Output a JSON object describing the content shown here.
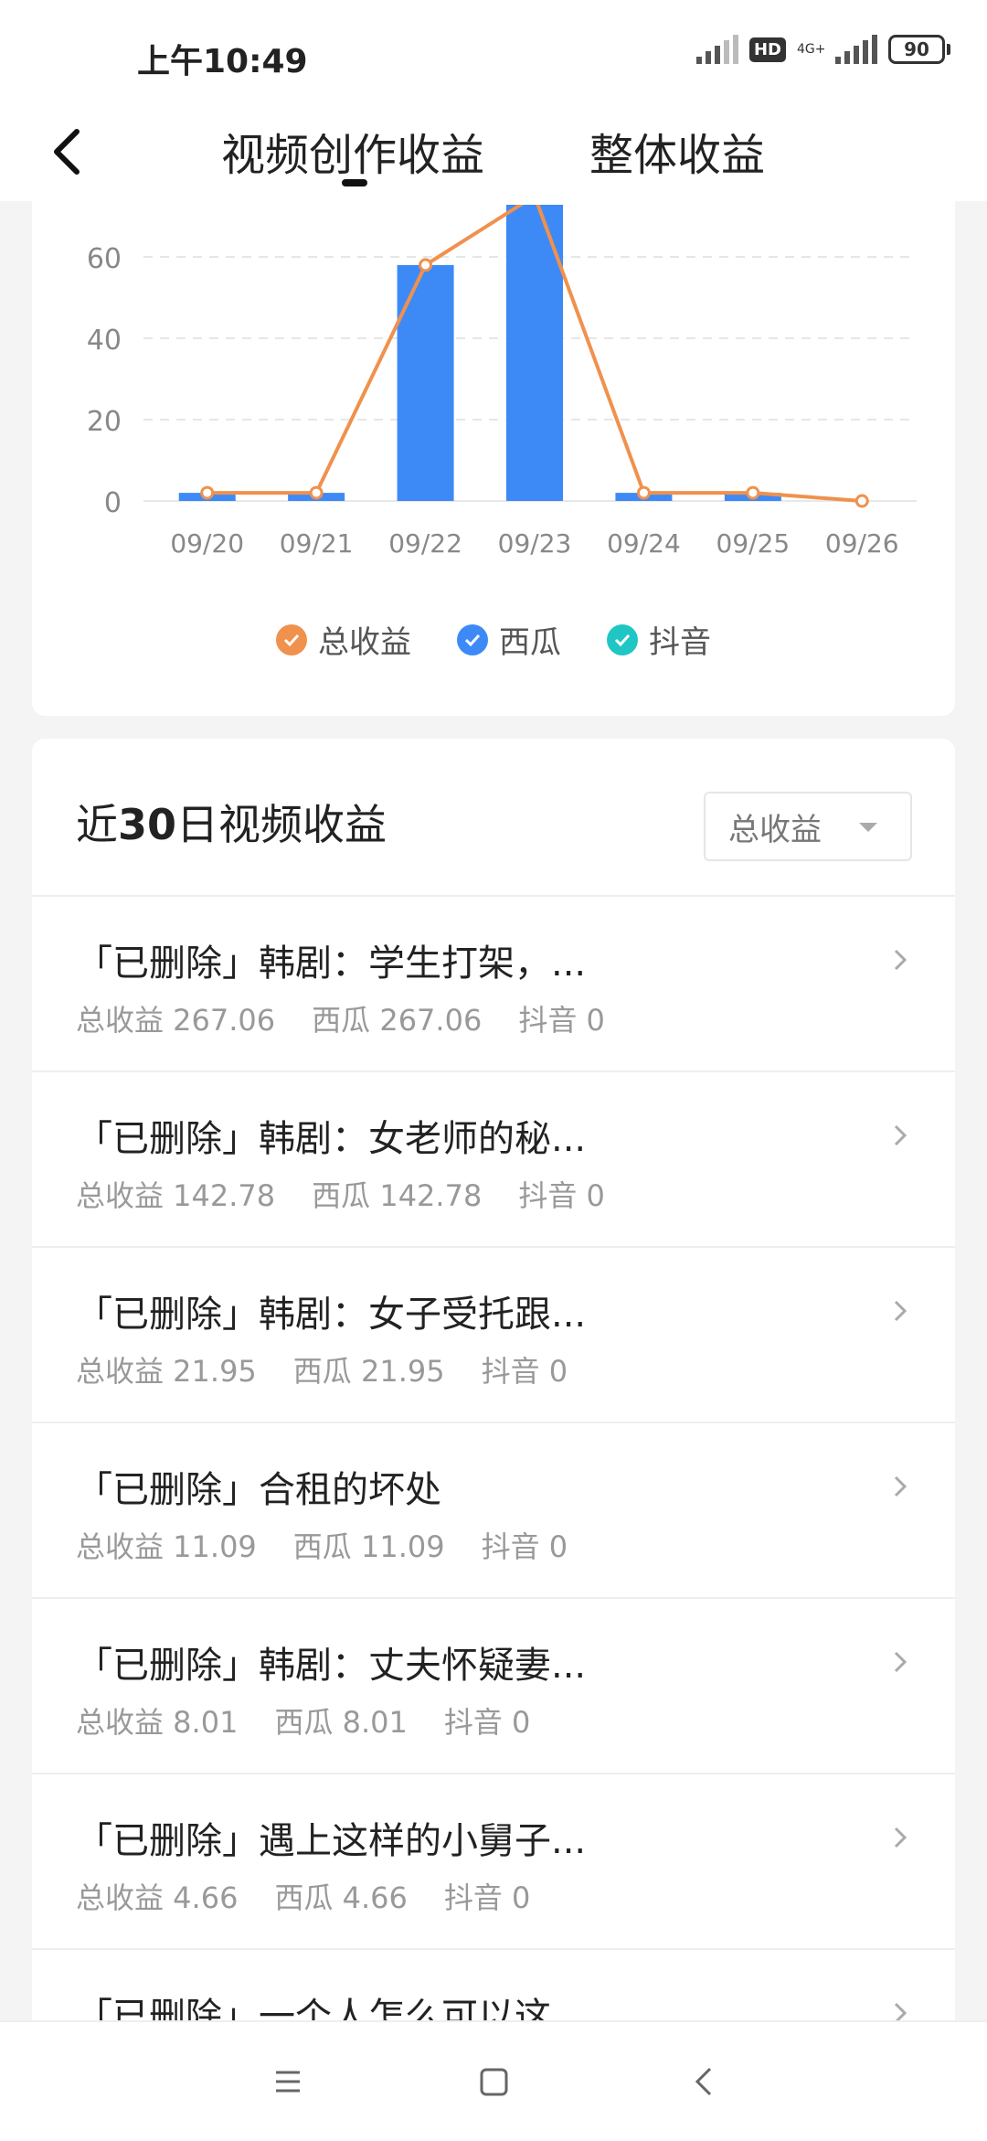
{
  "status_bar": {
    "time": "上午10:49",
    "hd": "HD",
    "network": "4G+",
    "battery": "90"
  },
  "header": {
    "tabs": [
      {
        "label": "视频创作收益",
        "active": true
      },
      {
        "label": "整体收益",
        "active": false
      }
    ]
  },
  "chart_data": {
    "type": "bar",
    "categories": [
      "09/20",
      "09/21",
      "09/22",
      "09/23",
      "09/24",
      "09/25",
      "09/26"
    ],
    "series": [
      {
        "name": "西瓜",
        "type": "bar",
        "values": [
          2,
          2,
          58,
          75,
          2,
          2,
          0
        ]
      },
      {
        "name": "抖音",
        "type": "bar",
        "values": [
          0,
          0,
          0,
          0,
          0,
          0,
          0
        ]
      },
      {
        "name": "总收益",
        "type": "line",
        "values": [
          2,
          2,
          58,
          75,
          2,
          2,
          0
        ]
      }
    ],
    "y_ticks": [
      "0",
      "20",
      "40",
      "60"
    ],
    "ylim": [
      0,
      75
    ],
    "grid": true,
    "legend_position": "bottom",
    "colors": {
      "总收益": "#f0914d",
      "西瓜": "#3d8af7",
      "抖音": "#20c6c4"
    }
  },
  "legend": [
    {
      "label": "总收益",
      "color": "#f0914d"
    },
    {
      "label": "西瓜",
      "color": "#3d8af7"
    },
    {
      "label": "抖音",
      "color": "#20c6c4"
    }
  ],
  "list": {
    "title_prefix": "近",
    "title_number": "30",
    "title_suffix": "日视频收益",
    "filter": "总收益",
    "items": [
      {
        "title": "「已删除」韩剧：学生打架，...",
        "total": "总收益 267.06",
        "xigua": "西瓜 267.06",
        "douyin": "抖音 0"
      },
      {
        "title": "「已删除」韩剧：女老师的秘...",
        "total": "总收益 142.78",
        "xigua": "西瓜 142.78",
        "douyin": "抖音 0"
      },
      {
        "title": "「已删除」韩剧：女子受托跟...",
        "total": "总收益 21.95",
        "xigua": "西瓜 21.95",
        "douyin": "抖音 0"
      },
      {
        "title": "「已删除」合租的坏处",
        "total": "总收益 11.09",
        "xigua": "西瓜 11.09",
        "douyin": "抖音 0"
      },
      {
        "title": "「已删除」韩剧：丈夫怀疑妻...",
        "total": "总收益 8.01",
        "xigua": "西瓜 8.01",
        "douyin": "抖音 0"
      },
      {
        "title": "「已删除」遇上这样的小舅子...",
        "total": "总收益 4.66",
        "xigua": "西瓜 4.66",
        "douyin": "抖音 0"
      },
      {
        "title": "「已删除」一个人怎么可以这...",
        "total": "",
        "xigua": "",
        "douyin": ""
      }
    ]
  },
  "nav_bar": {
    "icons": [
      "menu-icon",
      "home-icon",
      "back-icon"
    ]
  }
}
